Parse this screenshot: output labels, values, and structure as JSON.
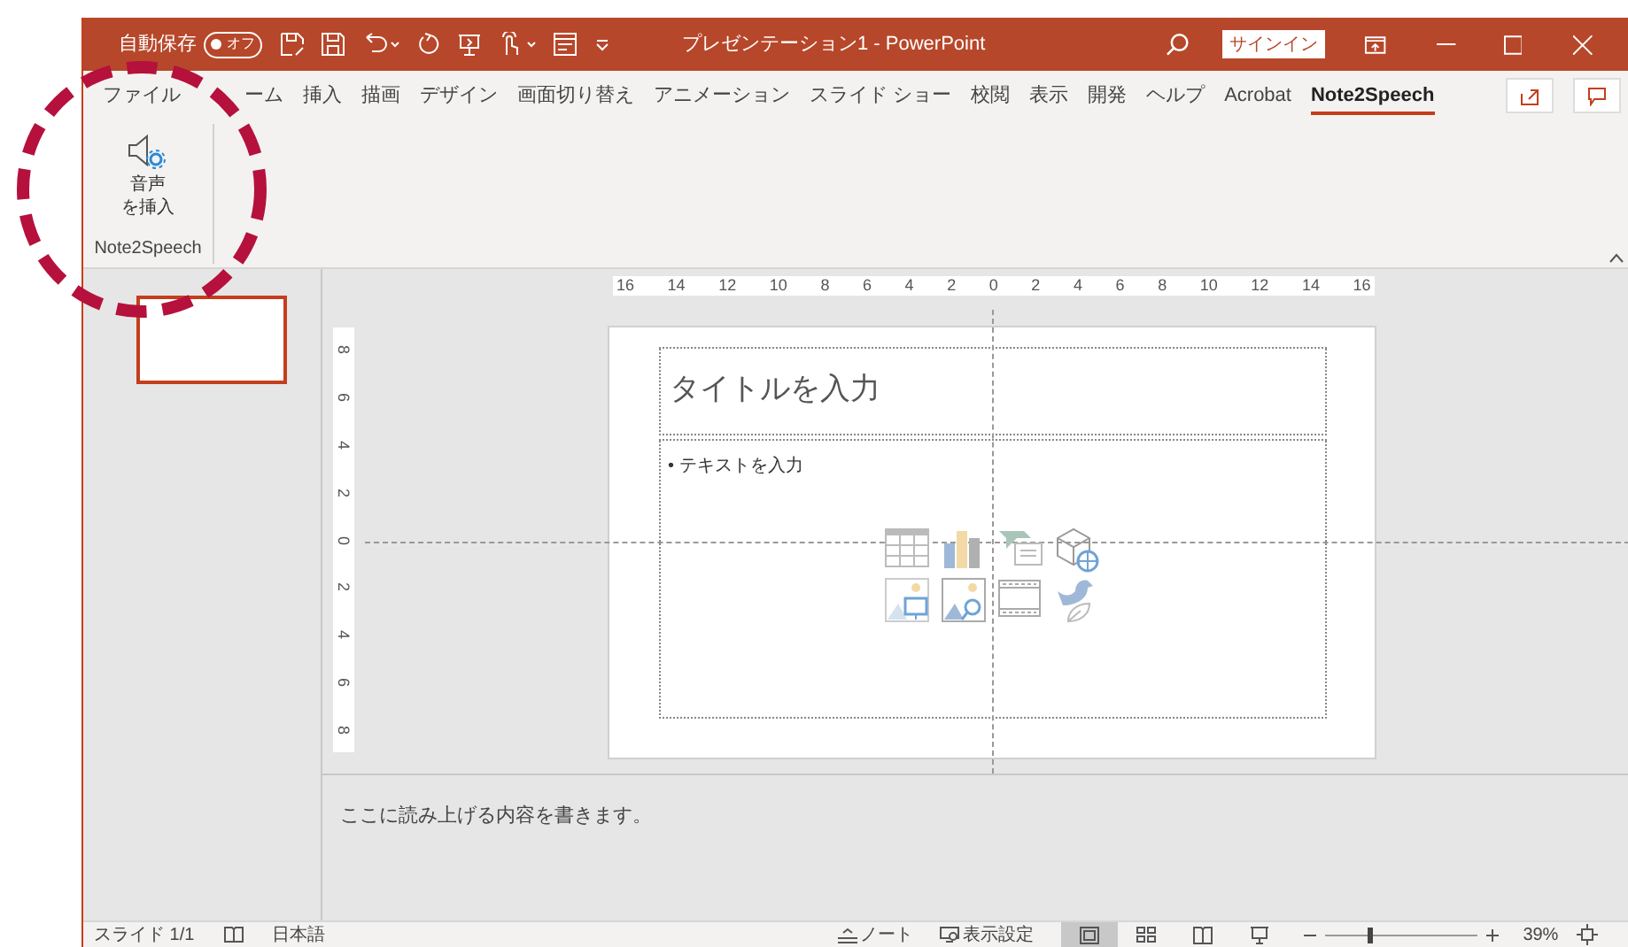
{
  "title_bar": {
    "autosave_label": "自動保存",
    "autosave_toggle": {
      "label": "オフ",
      "on": false
    },
    "title": "プレゼンテーション1 - PowerPoint",
    "sign_in": "サインイン"
  },
  "tabs": [
    {
      "label": "ファイル",
      "selected": false
    },
    {
      "label": "ーム",
      "selected": false
    },
    {
      "label": "挿入",
      "selected": false
    },
    {
      "label": "描画",
      "selected": false
    },
    {
      "label": "デザイン",
      "selected": false
    },
    {
      "label": "画面切り替え",
      "selected": false
    },
    {
      "label": "アニメーション",
      "selected": false
    },
    {
      "label": "スライド ショー",
      "selected": false
    },
    {
      "label": "校閲",
      "selected": false
    },
    {
      "label": "表示",
      "selected": false
    },
    {
      "label": "開発",
      "selected": false
    },
    {
      "label": "ヘルプ",
      "selected": false
    },
    {
      "label": "Acrobat",
      "selected": false
    },
    {
      "label": "Note2Speech",
      "selected": true
    }
  ],
  "ribbon": {
    "button_lines": [
      "音声",
      "を挿入"
    ],
    "group_label": "Note2Speech"
  },
  "rulers": {
    "horizontal": [
      "16",
      "14",
      "12",
      "10",
      "8",
      "6",
      "4",
      "2",
      "0",
      "2",
      "4",
      "6",
      "8",
      "10",
      "12",
      "14",
      "16"
    ],
    "vertical": [
      "8",
      "6",
      "4",
      "2",
      "0",
      "2",
      "4",
      "6",
      "8"
    ]
  },
  "slide": {
    "title_placeholder": "タイトルを入力",
    "body_placeholder": "• テキストを入力"
  },
  "notes": "ここに読み上げる内容を書きます。",
  "status_bar": {
    "slide": "スライド 1/1",
    "language": "日本語",
    "notes": "ノート",
    "display_settings": "表示設定",
    "views": [
      {
        "kind": "normal",
        "selected": true
      },
      {
        "kind": "sorter",
        "selected": false
      },
      {
        "kind": "reading",
        "selected": false
      },
      {
        "kind": "show",
        "selected": false
      }
    ],
    "zoom": {
      "level": 0.3,
      "reading": "39%"
    }
  }
}
